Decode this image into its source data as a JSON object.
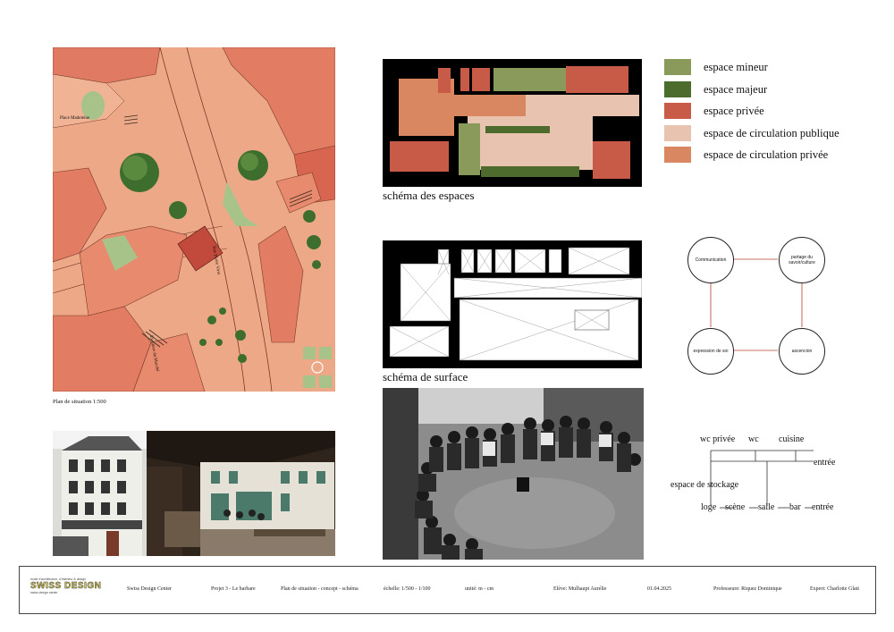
{
  "site_plan": {
    "caption": "Plan de situation 1:500",
    "labels": {
      "place": "Place Madeleine",
      "street1": "Rue Pierre Viret",
      "street2": "Escaliers du Marché"
    }
  },
  "space_schema": {
    "caption": "schéma des espaces"
  },
  "surface_schema": {
    "caption": "schéma de surface"
  },
  "legend": [
    {
      "label": "espace mineur",
      "color": "#8a9a5b"
    },
    {
      "label": "espace majeur",
      "color": "#4d6b2c"
    },
    {
      "label": "espace privée",
      "color": "#c85a48"
    },
    {
      "label": "espace de circulation publique",
      "color": "#e8c3b0"
    },
    {
      "label": "espace de circulation privée",
      "color": "#d98760"
    }
  ],
  "concept": {
    "nodes": [
      "Communication",
      "partage du savoir/culture",
      "expression de soi",
      "ascencion"
    ]
  },
  "tree": {
    "top": [
      "wc privée",
      "wc",
      "cuisine"
    ],
    "entree_top": "entrée",
    "stockage": "espace de stockage",
    "bottom": [
      "loge",
      "scène",
      "salle",
      "bar",
      "entrée"
    ]
  },
  "footer": {
    "logo_top": "école d'architecture, d'intérieur & design",
    "logo_main": "SWISS DESIGN",
    "logo_sub": "swiss design center",
    "fields": [
      "Swiss Design Center",
      "Projet 3 - Le barbare",
      "Plan de situation - concept - schéma",
      "échelle: 1/500 - 1/100",
      "unité: m - cm",
      "Elève: Mulhaupt Aurélie",
      "01.04.2025",
      "Professeure: Riquez Dominique",
      "Expert: Charlotte Glatt"
    ]
  }
}
